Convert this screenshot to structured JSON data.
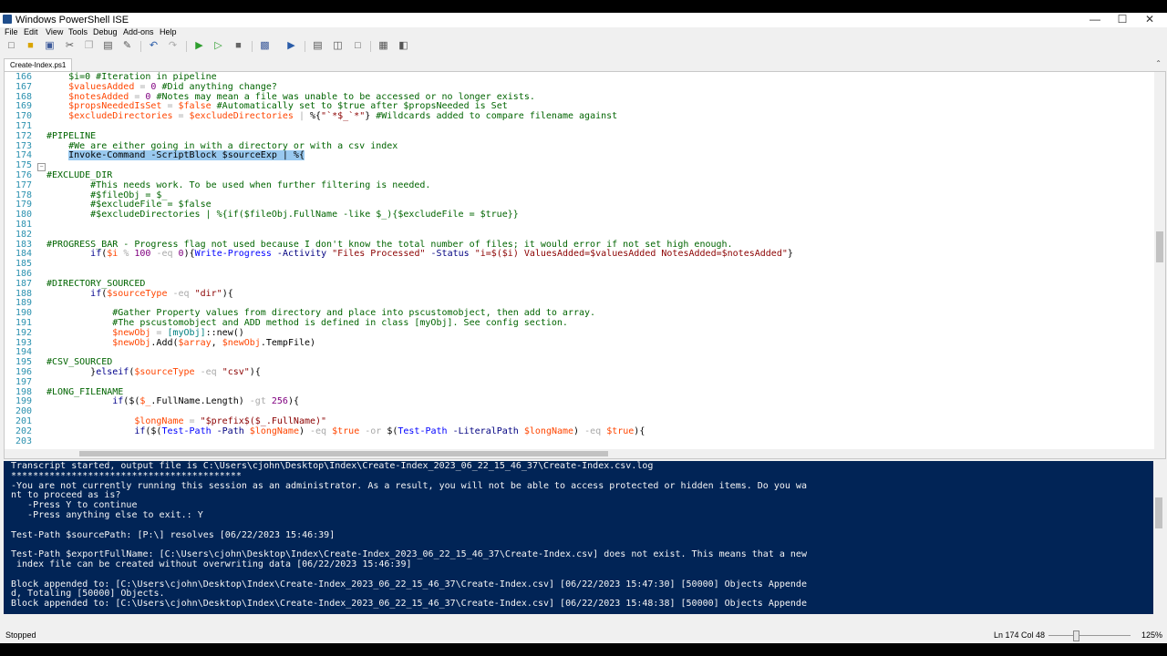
{
  "window": {
    "title": "Windows PowerShell ISE",
    "min": "—",
    "max": "☐",
    "close": "✕"
  },
  "menu": [
    "File",
    "Edit",
    "View",
    "Tools",
    "Debug",
    "Add-ons",
    "Help"
  ],
  "toolbar_icons": [
    "new-icon",
    "open-icon",
    "save-icon",
    "cut-icon",
    "copy-icon",
    "paste-icon",
    "clear-icon",
    "undo-icon",
    "redo-icon",
    "run-icon",
    "run-selection-icon",
    "stop-icon",
    "remote-powershell-icon",
    "console-icon",
    "script-pane-top-icon",
    "script-pane-right-icon",
    "script-pane-max-icon",
    "show-commands-icon",
    "command-addon-icon"
  ],
  "tab": {
    "label": "Create-Index.ps1",
    "dropdown": "⌃"
  },
  "editor": {
    "line_numbers": [
      "166",
      "167",
      "168",
      "169",
      "170",
      "171",
      "172",
      "173",
      "174",
      "175",
      "176",
      "177",
      "178",
      "179",
      "180",
      "181",
      "182",
      "183",
      "184",
      "185",
      "186",
      "187",
      "188",
      "189",
      "190",
      "191",
      "192",
      "193",
      "194",
      "195",
      "196",
      "197",
      "198",
      "199",
      "200",
      "201",
      "202",
      "203"
    ],
    "lines": [
      [
        {
          "t": "    $i=0 #Iteration in pipeline",
          "c": "cm"
        }
      ],
      [
        {
          "t": "    ",
          "c": ""
        },
        {
          "t": "$valuesAdded",
          "c": "vr"
        },
        {
          "t": " = ",
          "c": "op"
        },
        {
          "t": "0",
          "c": "nm"
        },
        {
          "t": " #Did anything change?",
          "c": "cm"
        }
      ],
      [
        {
          "t": "    ",
          "c": ""
        },
        {
          "t": "$notesAdded",
          "c": "vr"
        },
        {
          "t": " = ",
          "c": "op"
        },
        {
          "t": "0",
          "c": "nm"
        },
        {
          "t": " #Notes may mean a file was unable to be accessed or no longer exists.",
          "c": "cm"
        }
      ],
      [
        {
          "t": "    ",
          "c": ""
        },
        {
          "t": "$propsNeededIsSet",
          "c": "vr"
        },
        {
          "t": " = ",
          "c": "op"
        },
        {
          "t": "$false",
          "c": "vr"
        },
        {
          "t": " #Automatically set to $true after $propsNeeded is Set",
          "c": "cm"
        }
      ],
      [
        {
          "t": "    ",
          "c": ""
        },
        {
          "t": "$excludeDirectories",
          "c": "vr"
        },
        {
          "t": " = ",
          "c": "op"
        },
        {
          "t": "$excludeDirectories",
          "c": "vr"
        },
        {
          "t": " | ",
          "c": "op"
        },
        {
          "t": "%{",
          "c": ""
        },
        {
          "t": "\"`*$_`*\"",
          "c": "str"
        },
        {
          "t": "}",
          "c": ""
        },
        {
          "t": " #Wildcards added to compare filename against",
          "c": "cm"
        }
      ],
      [
        {
          "t": "",
          "c": ""
        }
      ],
      [
        {
          "t": "#PIPELINE",
          "c": "cm"
        }
      ],
      [
        {
          "t": "    #We are either going in with a directory or with a csv index",
          "c": "cm"
        }
      ],
      [
        {
          "t": "    ",
          "c": ""
        },
        {
          "t": "Invoke-Command -ScriptBlock $sourceExp | %{",
          "c": "sel"
        }
      ],
      [
        {
          "t": "",
          "c": ""
        }
      ],
      [
        {
          "t": "#EXCLUDE_DIR",
          "c": "cm"
        }
      ],
      [
        {
          "t": "        #This needs work. To be used when further filtering is needed.",
          "c": "cm"
        }
      ],
      [
        {
          "t": "        #$fileObj = $_",
          "c": "cm"
        }
      ],
      [
        {
          "t": "        #$excludeFile = $false",
          "c": "cm"
        }
      ],
      [
        {
          "t": "        #$excludeDirectories | %{if($fileObj.FullName -like $_){$excludeFile = $true}}",
          "c": "cm"
        }
      ],
      [
        {
          "t": "",
          "c": ""
        }
      ],
      [
        {
          "t": "",
          "c": ""
        }
      ],
      [
        {
          "t": "#PROGRESS_BAR - Progress flag not used because I don't know the total number of files; it would error if not set high enough.",
          "c": "cm"
        }
      ],
      [
        {
          "t": "        ",
          "c": ""
        },
        {
          "t": "if",
          "c": "kw"
        },
        {
          "t": "(",
          "c": ""
        },
        {
          "t": "$i",
          "c": "vr"
        },
        {
          "t": " % ",
          "c": "op"
        },
        {
          "t": "100",
          "c": "nm"
        },
        {
          "t": " -eq ",
          "c": "op"
        },
        {
          "t": "0",
          "c": "nm"
        },
        {
          "t": "){",
          "c": ""
        },
        {
          "t": "Write-Progress",
          "c": "cmd"
        },
        {
          "t": " -Activity ",
          "c": "prm"
        },
        {
          "t": "\"Files Processed\"",
          "c": "str"
        },
        {
          "t": " -Status ",
          "c": "prm"
        },
        {
          "t": "\"i=$($i) ValuesAdded=$valuesAdded NotesAdded=$notesAdded\"",
          "c": "str"
        },
        {
          "t": "}",
          "c": ""
        }
      ],
      [
        {
          "t": "",
          "c": ""
        }
      ],
      [
        {
          "t": "",
          "c": ""
        }
      ],
      [
        {
          "t": "#DIRECTORY_SOURCED",
          "c": "cm"
        }
      ],
      [
        {
          "t": "        ",
          "c": ""
        },
        {
          "t": "if",
          "c": "kw"
        },
        {
          "t": "(",
          "c": ""
        },
        {
          "t": "$sourceType",
          "c": "vr"
        },
        {
          "t": " -eq ",
          "c": "op"
        },
        {
          "t": "\"dir\"",
          "c": "str"
        },
        {
          "t": "){",
          "c": ""
        }
      ],
      [
        {
          "t": "",
          "c": ""
        }
      ],
      [
        {
          "t": "            #Gather Property values from directory and place into pscustomobject, then add to array.",
          "c": "cm"
        }
      ],
      [
        {
          "t": "            #The pscustomobject and ADD method is defined in class [myObj]. See config section.",
          "c": "cm"
        }
      ],
      [
        {
          "t": "            ",
          "c": ""
        },
        {
          "t": "$newObj",
          "c": "vr"
        },
        {
          "t": " = ",
          "c": "op"
        },
        {
          "t": "[myObj]",
          "c": "ty"
        },
        {
          "t": "::new()",
          "c": ""
        }
      ],
      [
        {
          "t": "            ",
          "c": ""
        },
        {
          "t": "$newObj",
          "c": "vr"
        },
        {
          "t": ".Add(",
          "c": ""
        },
        {
          "t": "$array",
          "c": "vr"
        },
        {
          "t": ", ",
          "c": ""
        },
        {
          "t": "$newObj",
          "c": "vr"
        },
        {
          "t": ".TempFile)",
          "c": ""
        }
      ],
      [
        {
          "t": "",
          "c": ""
        }
      ],
      [
        {
          "t": "#CSV_SOURCED",
          "c": "cm"
        }
      ],
      [
        {
          "t": "        }",
          "c": ""
        },
        {
          "t": "elseif",
          "c": "kw"
        },
        {
          "t": "(",
          "c": ""
        },
        {
          "t": "$sourceType",
          "c": "vr"
        },
        {
          "t": " -eq ",
          "c": "op"
        },
        {
          "t": "\"csv\"",
          "c": "str"
        },
        {
          "t": "){",
          "c": ""
        }
      ],
      [
        {
          "t": "",
          "c": ""
        }
      ],
      [
        {
          "t": "#LONG_FILENAME",
          "c": "cm"
        }
      ],
      [
        {
          "t": "            ",
          "c": ""
        },
        {
          "t": "if",
          "c": "kw"
        },
        {
          "t": "($(",
          "c": ""
        },
        {
          "t": "$_",
          "c": "vr"
        },
        {
          "t": ".FullName.Length) ",
          "c": ""
        },
        {
          "t": "-gt ",
          "c": "op"
        },
        {
          "t": "256",
          "c": "nm"
        },
        {
          "t": "){",
          "c": ""
        }
      ],
      [
        {
          "t": "",
          "c": ""
        }
      ],
      [
        {
          "t": "                ",
          "c": ""
        },
        {
          "t": "$longName",
          "c": "vr"
        },
        {
          "t": " = ",
          "c": "op"
        },
        {
          "t": "\"$prefix$($_.FullName)\"",
          "c": "str"
        }
      ],
      [
        {
          "t": "                ",
          "c": ""
        },
        {
          "t": "if",
          "c": "kw"
        },
        {
          "t": "($(",
          "c": ""
        },
        {
          "t": "Test-Path",
          "c": "cmd"
        },
        {
          "t": " -Path ",
          "c": "prm"
        },
        {
          "t": "$longName",
          "c": "vr"
        },
        {
          "t": ") ",
          "c": ""
        },
        {
          "t": "-eq ",
          "c": "op"
        },
        {
          "t": "$true",
          "c": "vr"
        },
        {
          "t": " -or ",
          "c": "op"
        },
        {
          "t": "$(",
          "c": ""
        },
        {
          "t": "Test-Path",
          "c": "cmd"
        },
        {
          "t": " -LiteralPath ",
          "c": "prm"
        },
        {
          "t": "$longName",
          "c": "vr"
        },
        {
          "t": ") ",
          "c": ""
        },
        {
          "t": "-eq ",
          "c": "op"
        },
        {
          "t": "$true",
          "c": "vr"
        },
        {
          "t": "){",
          "c": ""
        }
      ],
      [
        {
          "t": "",
          "c": ""
        }
      ]
    ]
  },
  "console": {
    "lines": [
      "Transcript started, output file is C:\\Users\\cjohn\\Desktop\\Index\\Create-Index_2023_06_22_15_46_37\\Create-Index.csv.log",
      "******************************************",
      "-You are not currently running this session as an administrator. As a result, you will not be able to access protected or hidden items. Do you wa",
      "nt to proceed as is?",
      "   -Press Y to continue",
      "   -Press anything else to exit.: Y",
      "",
      "Test-Path $sourcePath: [P:\\] resolves [06/22/2023 15:46:39]",
      "",
      "Test-Path $exportFullName: [C:\\Users\\cjohn\\Desktop\\Index\\Create-Index_2023_06_22_15_46_37\\Create-Index.csv] does not exist. This means that a new",
      " index file can be created without overwriting data [06/22/2023 15:46:39]",
      "",
      "Block appended to: [C:\\Users\\cjohn\\Desktop\\Index\\Create-Index_2023_06_22_15_46_37\\Create-Index.csv] [06/22/2023 15:47:30] [50000] Objects Appende",
      "d, Totaling [50000] Objects.",
      "Block appended to: [C:\\Users\\cjohn\\Desktop\\Index\\Create-Index_2023_06_22_15_46_37\\Create-Index.csv] [06/22/2023 15:48:38] [50000] Objects Appende"
    ]
  },
  "status": {
    "state": "Stopped",
    "position": "Ln 174  Col 48",
    "zoom": "125%"
  }
}
